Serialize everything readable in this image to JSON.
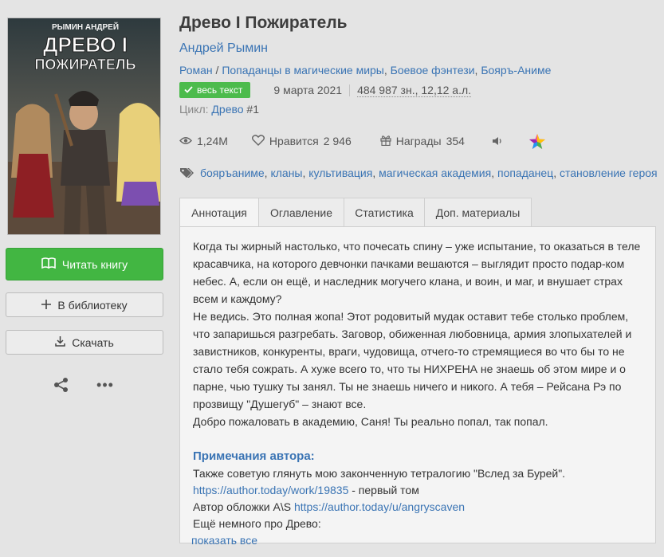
{
  "book": {
    "title": "Древо I Пожиратель",
    "author": "Андрей Рымин",
    "genre_prefix": "Роман",
    "genre_sep": " / ",
    "genres": [
      "Попаданцы в магические миры",
      "Боевое фэнтези",
      "Бояръ-Аниме"
    ],
    "badge_text": "весь текст",
    "date": "9 марта 2021",
    "size": "484 987 зн., 12,12 а.л.",
    "cycle_label": "Цикл: ",
    "cycle_name": "Древо",
    "cycle_num": " #1"
  },
  "cover": {
    "author_text": "РЫМИН АНДРЕЙ",
    "title_line1": "ДРЕВО I",
    "title_line2": "ПОЖИРАТЕЛЬ"
  },
  "stats": {
    "views": "1,24М",
    "likes_label": "Нравится",
    "likes": "2 946",
    "awards_label": "Награды",
    "awards": "354"
  },
  "tags": [
    "бояръаниме",
    "кланы",
    "культивация",
    "магическая академия",
    "попаданец",
    "становление героя"
  ],
  "buttons": {
    "read": "Читать книгу",
    "library": "В библиотеку",
    "download": "Скачать"
  },
  "tabs": [
    "Аннотация",
    "Оглавление",
    "Статистика",
    "Доп. материалы"
  ],
  "annotation": [
    "Когда ты жирный настолько, что почесать спину – уже испытание, то оказаться в теле красавчика, на которого девчонки пачками вешаются – выглядит просто подар-ком небес. А, если он ещё, и наследник могучего клана, и воин, и маг, и внушает страх всем и каждому?",
    "Не ведись. Это полная жопа! Этот родовитый мудак оставит тебе столько проблем, что запаришься разгребать. Заговор, обиженная любовница, армия злопыхателей и завистников, конкуренты, враги, чудовища, отчего-то стремящиеся во что бы то не стало тебя сожрать. А хуже всего то, что ты НИХРЕНА не знаешь об этом мире и о парне, чью тушку ты занял. Ты не знаешь ничего и никого. А тебя – Рейсана Рэ по прозвищу \"Душегуб\" – знают все.",
    "Добро пожаловать в академию, Саня! Ты реально попал, так попал."
  ],
  "notes": {
    "heading": "Примечания автора:",
    "line1": "Также советую глянуть мою законченную тетралогию \"Вслед за Бурей\".",
    "link1": "https://author.today/work/19835",
    "link1_suffix": " - первый том",
    "line3_prefix": "Автор обложки A\\S ",
    "link2": "https://author.today/u/angryscaven",
    "line4": "Ещё немного про Древо:",
    "show_all": "показать все"
  },
  "colors": {
    "accent": "#3a74b4",
    "read_button": "#42b642",
    "badge": "#4cbb4c",
    "background": "#e4e4e4"
  },
  "icons": [
    "book-icon",
    "plus-icon",
    "download-icon",
    "share-icon",
    "more-icon",
    "check-icon",
    "eye-icon",
    "heart-icon",
    "gift-icon",
    "speaker-icon",
    "star-icon",
    "tag-icon"
  ]
}
